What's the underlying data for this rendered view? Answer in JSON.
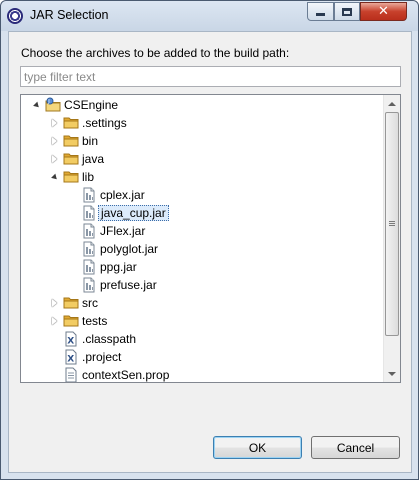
{
  "window": {
    "title": "JAR Selection"
  },
  "dialog": {
    "prompt": "Choose the archives to be added to the build path:",
    "filter": {
      "placeholder": "type filter text",
      "value": ""
    },
    "buttons": {
      "ok": "OK",
      "cancel": "Cancel"
    }
  },
  "tree": {
    "root": {
      "label": "CSEngine",
      "icon": "project-icon",
      "expanded": true
    },
    "items": [
      {
        "label": ".settings",
        "icon": "folder-icon",
        "twisty": "closed"
      },
      {
        "label": "bin",
        "icon": "folder-icon",
        "twisty": "closed"
      },
      {
        "label": "java",
        "icon": "folder-icon",
        "twisty": "closed"
      },
      {
        "label": "lib",
        "icon": "folder-icon",
        "twisty": "open"
      },
      {
        "label": "cplex.jar",
        "icon": "jar-icon"
      },
      {
        "label": "java_cup.jar",
        "icon": "jar-icon",
        "selected": true
      },
      {
        "label": "JFlex.jar",
        "icon": "jar-icon"
      },
      {
        "label": "polyglot.jar",
        "icon": "jar-icon"
      },
      {
        "label": "ppg.jar",
        "icon": "jar-icon"
      },
      {
        "label": "prefuse.jar",
        "icon": "jar-icon"
      },
      {
        "label": "src",
        "icon": "folder-icon",
        "twisty": "closed"
      },
      {
        "label": "tests",
        "icon": "folder-icon",
        "twisty": "closed"
      },
      {
        "label": ".classpath",
        "icon": "xml-file-icon"
      },
      {
        "label": ".project",
        "icon": "xml-file-icon"
      },
      {
        "label": "contextSen.prop",
        "icon": "text-file-icon"
      }
    ]
  },
  "colors": {
    "selection_bg": "#dcebfb",
    "selection_border": "#3d6da8",
    "folder": "#e8b84a",
    "title_bg": "#c9d6e6"
  }
}
